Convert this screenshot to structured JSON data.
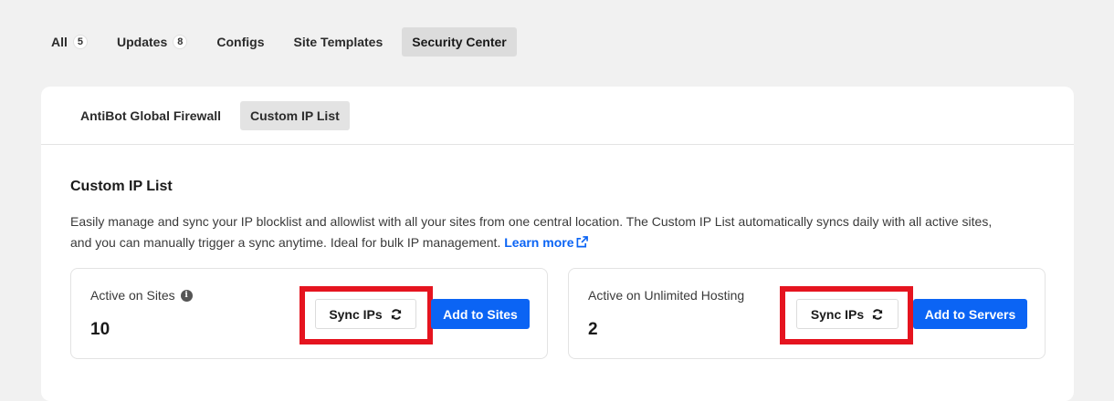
{
  "top_tabs": [
    {
      "label": "All",
      "count": "5"
    },
    {
      "label": "Updates",
      "count": "8"
    },
    {
      "label": "Configs"
    },
    {
      "label": "Site Templates"
    },
    {
      "label": "Security Center",
      "active": true
    }
  ],
  "sub_tabs": [
    {
      "label": "AntiBot Global Firewall"
    },
    {
      "label": "Custom IP List",
      "active": true
    }
  ],
  "section": {
    "title": "Custom IP List",
    "description": "Easily manage and sync your IP blocklist and allowlist with all your sites from one central location. The Custom IP List automatically syncs daily with all active sites, and you can manually trigger a sync anytime. Ideal for bulk IP management.",
    "learn_more": "Learn more"
  },
  "stats": {
    "sites": {
      "label": "Active on Sites",
      "value": "10",
      "sync_label": "Sync IPs",
      "action_label": "Add to Sites"
    },
    "hosting": {
      "label": "Active on Unlimited Hosting",
      "value": "2",
      "sync_label": "Sync IPs",
      "action_label": "Add to Servers"
    }
  },
  "colors": {
    "accent": "#0b64f4",
    "highlight": "#e5141f"
  },
  "icons": {
    "info": "info-icon",
    "sync": "sync-icon",
    "external_link": "external-link-icon"
  }
}
